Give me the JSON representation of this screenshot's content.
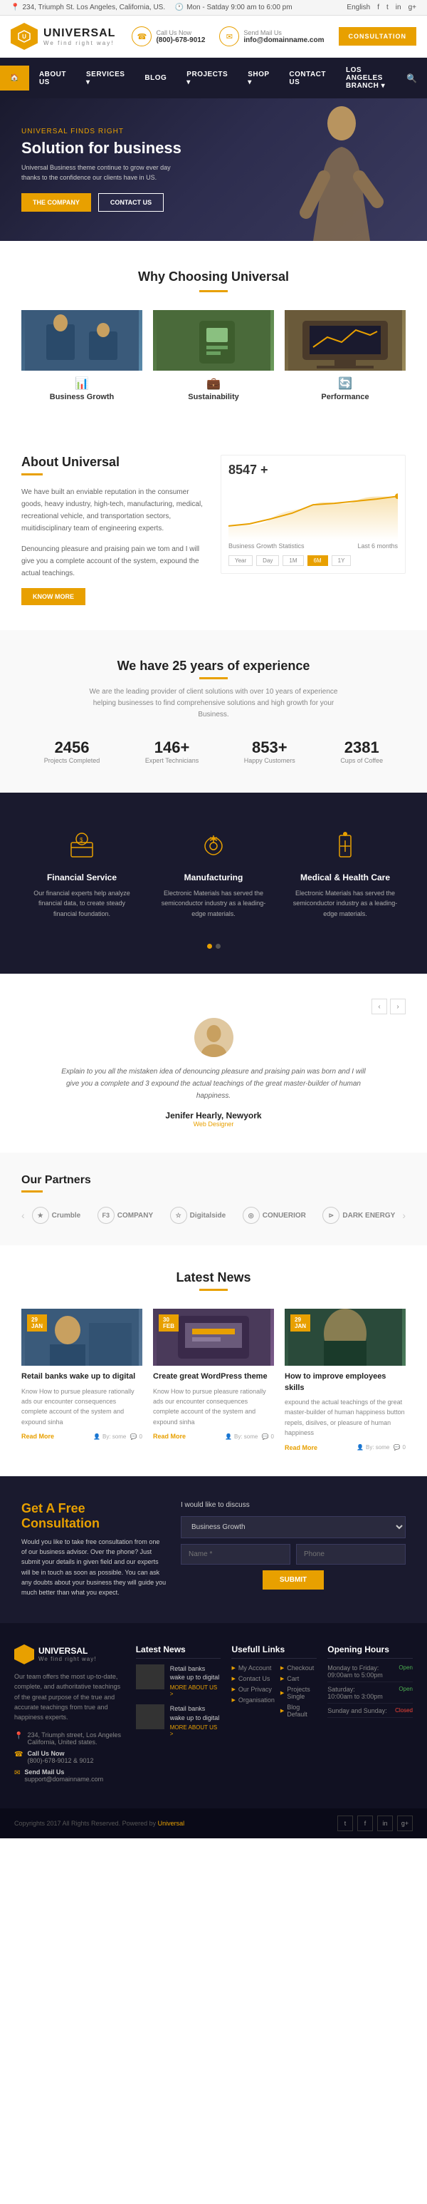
{
  "topbar": {
    "address": "234, Triumph St. Los Angeles, California, US.",
    "hours": "Mon - Satday 9:00 am to 6:00 pm",
    "language": "English",
    "social_links": [
      "f",
      "t",
      "in",
      "g+"
    ]
  },
  "header": {
    "logo_name": "UNIVERSAL",
    "logo_tagline": "We find right way!",
    "phone_label": "Call Us Now",
    "phone_number": "(800)-678-9012",
    "email_label": "Send Mail Us",
    "email_address": "info@domainname.com",
    "consultation_btn": "CONSULTATION"
  },
  "nav": {
    "items": [
      "HOME",
      "ABOUT US",
      "SERVICES",
      "BLOG",
      "PROJECTS",
      "SHOP",
      "CONTACT US",
      "Los Angeles Branch"
    ],
    "home_active": true
  },
  "hero": {
    "tag": "Universal Finds Right",
    "title": "Solution for business",
    "description": "Universal Business theme continue to grow ever day thanks to the confidence our clients have in US.",
    "btn1": "THE COMPANY",
    "btn2": "CONTACT US"
  },
  "why_section": {
    "title": "Why Choosing Universal",
    "features": [
      {
        "name": "Business Growth",
        "icon": "📊"
      },
      {
        "name": "Sustainability",
        "icon": "💼"
      },
      {
        "name": "Performance",
        "icon": "🔄"
      }
    ]
  },
  "about": {
    "title": "About Universal",
    "text1": "We have built an enviable reputation in the consumer goods, heavy industry, high-tech, manufacturing, medical, recreational vehicle, and transportation sectors, muitidisciplinary team of engineering experts.",
    "text2": "Denouncing pleasure and praising pain we tom and I will give you a complete account of the system, expound the actual teachings.",
    "btn": "KNOW MORE",
    "chart": {
      "number": "8547 +",
      "title": "Business Growth Statistics",
      "period": "Last 6 months",
      "tabs": [
        "Year",
        "Day",
        "1M",
        "6M",
        "1Y"
      ]
    }
  },
  "experience": {
    "title": "We have 25 years of experience",
    "description": "We are the leading provider of client solutions with over 10 years of experience helping businesses to find comprehensive solutions and high growth for your Business.",
    "stats": [
      {
        "number": "2456",
        "label": "Projects Completed"
      },
      {
        "number": "146+",
        "label": "Expert Technicians"
      },
      {
        "number": "853+",
        "label": "Happy Customers"
      },
      {
        "number": "2381",
        "label": "Cups of Coffee"
      }
    ]
  },
  "services": {
    "items": [
      {
        "icon": "🏦",
        "title": "Financial Service",
        "description": "Our financial experts help analyze financial data, to create steady financial foundation."
      },
      {
        "icon": "⚗️",
        "title": "Manufacturing",
        "description": "Electronic Materials has served the semiconductor industry as a leading-edge materials."
      },
      {
        "icon": "🏥",
        "title": "Medical & Health Care",
        "description": "Electronic Materials has served the semiconductor industry as a leading-edge materials."
      }
    ]
  },
  "testimonial": {
    "text": "Explain to you all the mistaken idea of denouncing pleasure and praising pain was born and I will give you a complete and 3 expound the actual teachings of the great master-builder of human happiness.",
    "name": "Jenifer Hearly, Newyork",
    "role": "Web Designer"
  },
  "partners": {
    "title": "Our Partners",
    "logos": [
      "★ Crumble",
      "F3 COMPANY",
      "☆ Digitalside",
      "◎ CONUERIOR",
      "⊳ DARK ENERGY"
    ]
  },
  "news": {
    "title": "Latest News",
    "articles": [
      {
        "date": "29",
        "month": "JAN",
        "title": "Retail banks wake up to digital",
        "text": "Know How to pursue pleasure rationally ads our encounter consequences complete account of the system and expound sinha",
        "author": "By: some",
        "comments": "0"
      },
      {
        "date": "30",
        "month": "FEB",
        "title": "Create great WordPress theme",
        "text": "Know How to pursue pleasure rationally ads our encounter consequences complete account of the system and expound sinha",
        "author": "By: some",
        "comments": "0"
      },
      {
        "date": "29",
        "month": "JAN",
        "title": "How to improve employees skills",
        "text": "expound the actual teachings of the great master-builder of human happiness button repels, disilves, or pleasure of human happiness",
        "author": "By: some",
        "comments": "0"
      }
    ]
  },
  "cta": {
    "title": "Get A Free Consultation",
    "description": "Would you like to take free consultation from one of our business advisor. Over the phone? Just submit your details in given field and our experts will be in touch as soon as possible. You can ask any doubts about your business they will guide you much better than what you expect.",
    "form_title": "I would like to discuss",
    "select_default": "Business Growth",
    "name_placeholder": "Name *",
    "phone_placeholder": "Phone",
    "submit_btn": "SUBMIT"
  },
  "footer": {
    "logo": "UNIVERSAL",
    "tagline": "We find right way!",
    "description": "Our team offers the most up-to-date, complete, and authoritative teachings of the great purpose of the true and accurate teachings from true and happiness experts.",
    "address": "234, Triumph street, Los Angeles California, United states.",
    "phone_label": "Call Us Now",
    "phone": "(800)-678-9012 & 9012",
    "email_label": "Send Mail Us",
    "email": "support@domainname.com",
    "news_title": "Latest News",
    "news_items": [
      {
        "title": "Retail banks wake up to digital"
      },
      {
        "title": "Retail banks wake up to digital"
      }
    ],
    "news_more": "MORE ABOUT US >",
    "useful_links_title": "Usefull Links",
    "links": [
      "My Account",
      "Checkout",
      "Cart",
      "Contact Us",
      "Projects Single",
      "Our Privacy",
      "Blog Default",
      "Organisation"
    ],
    "hours_title": "Opening Hours",
    "hours": [
      {
        "day": "Monday to Friday:",
        "time": "09:00am to 5:00pm",
        "status": "Open"
      },
      {
        "day": "Saturday:",
        "time": "10:00am to 3:00pm",
        "status": "Open"
      },
      {
        "day": "Sunday and Sunday:",
        "time": "",
        "status": "Closed"
      }
    ]
  },
  "footer_bottom": {
    "copy": "Copyrights 2017 All Rights Reserved. Powered by Universal",
    "brand": "Universal"
  }
}
